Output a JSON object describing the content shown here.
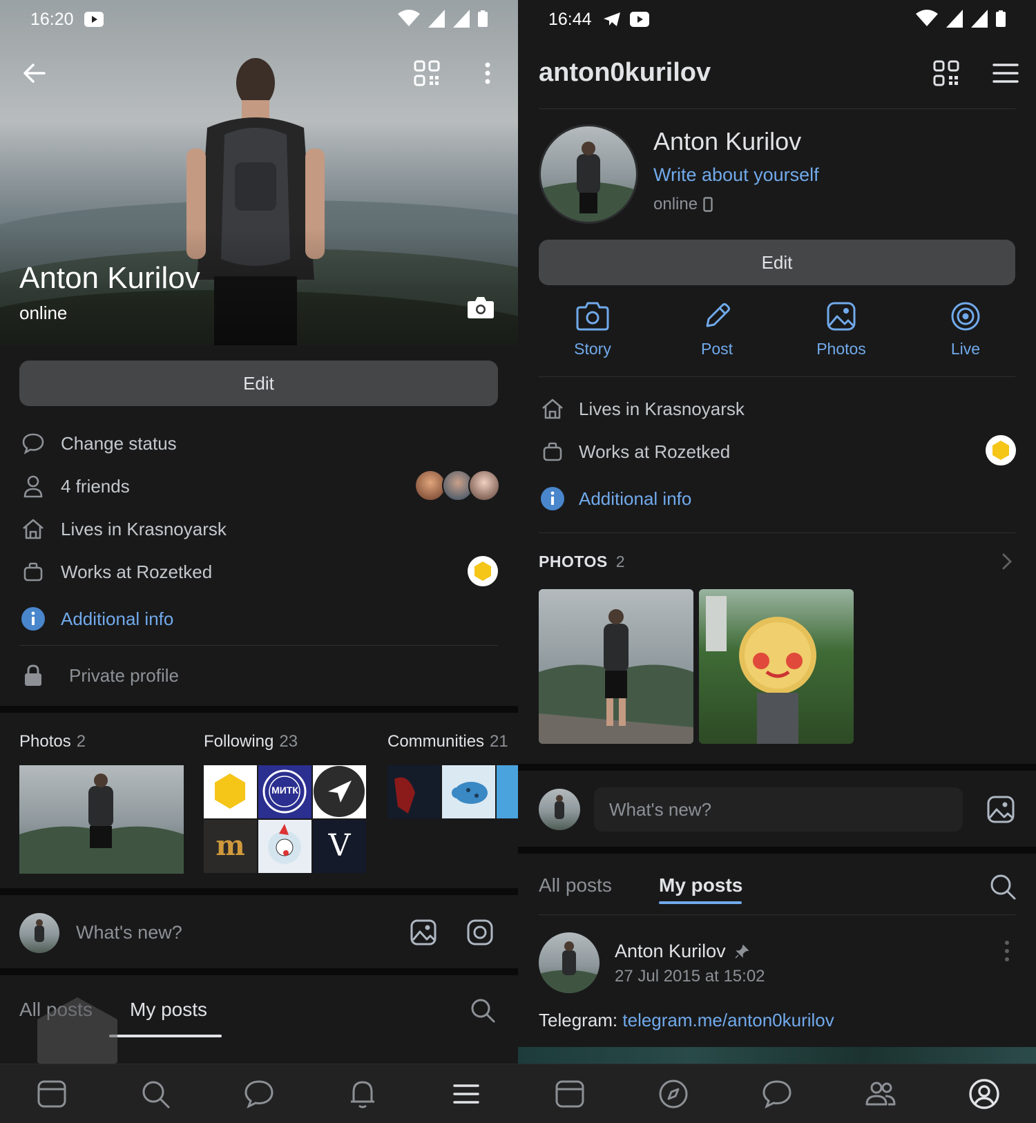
{
  "left": {
    "status_time": "16:20",
    "name": "Anton Kurilov",
    "online": "online",
    "edit_label": "Edit",
    "rows": {
      "change_status": "Change status",
      "friends": "4 friends",
      "city": "Lives in Krasnoyarsk",
      "work": "Works at Rozetked",
      "additional": "Additional info",
      "private": "Private profile"
    },
    "sections": {
      "photos": {
        "label": "Photos",
        "count": "2"
      },
      "following": {
        "label": "Following",
        "count": "23"
      },
      "communities": {
        "label": "Communities",
        "count": "21"
      }
    },
    "following_tiles": [
      "МИТК",
      "m",
      "V"
    ],
    "composer_placeholder": "What's new?",
    "tabs": {
      "all": "All posts",
      "mine": "My posts"
    }
  },
  "right": {
    "status_time": "16:44",
    "username": "anton0kurilov",
    "name": "Anton Kurilov",
    "about": "Write about yourself",
    "online": "online",
    "edit_label": "Edit",
    "actions": [
      "Story",
      "Post",
      "Photos",
      "Live"
    ],
    "rows": {
      "city": "Lives in Krasnoyarsk",
      "work": "Works at Rozetked",
      "additional": "Additional info"
    },
    "photos_section": {
      "label": "PHOTOS",
      "count": "2"
    },
    "composer_placeholder": "What's new?",
    "tabs": {
      "all": "All posts",
      "mine": "My posts"
    },
    "post": {
      "author": "Anton Kurilov",
      "date": "27 Jul 2015 at 15:02",
      "text_prefix": "Telegram: ",
      "link": "telegram.me/anton0kurilov"
    }
  },
  "colors": {
    "accent": "#71aaeb",
    "background": "#19191a",
    "button": "#454647",
    "text_secondary": "#8d9196"
  }
}
